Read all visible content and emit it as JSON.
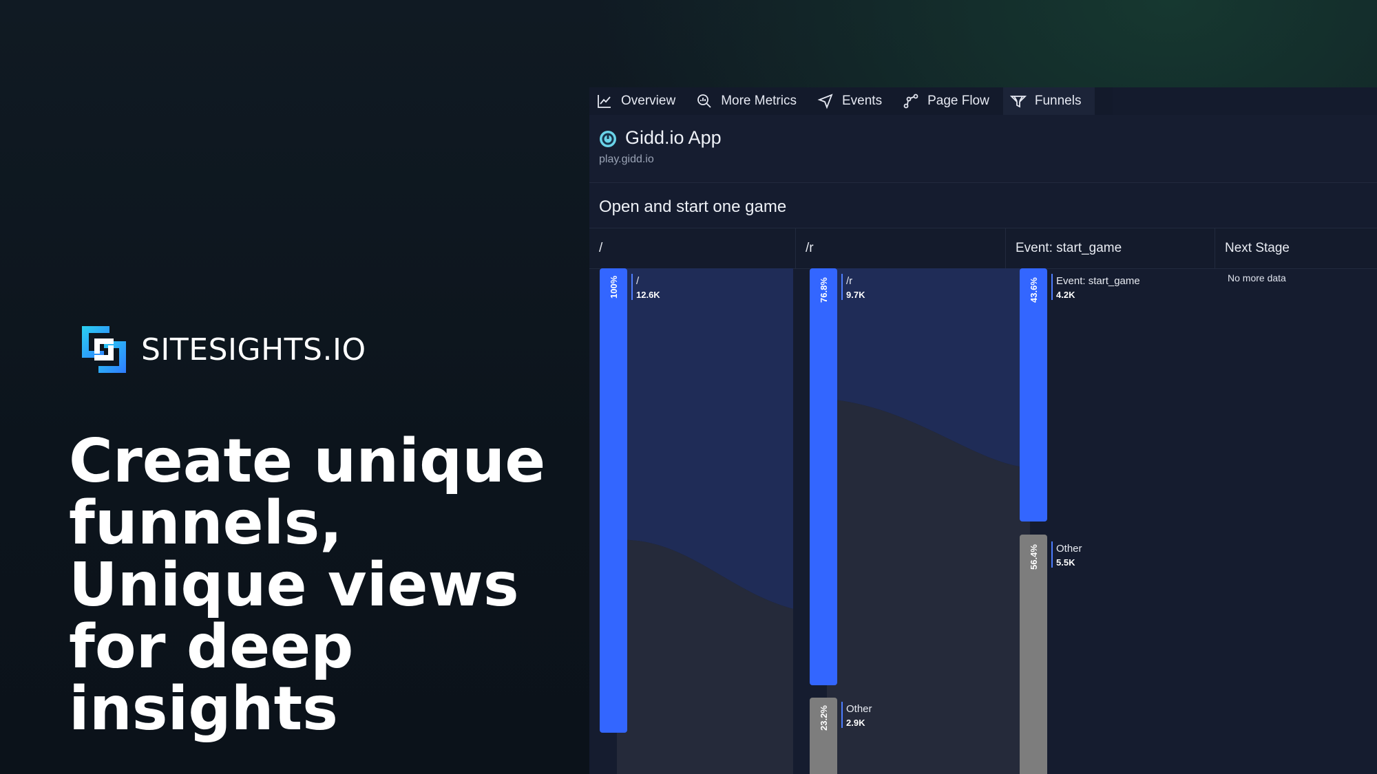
{
  "brand": {
    "name": "SITESIGHTS.IO"
  },
  "headline": "Create unique funnels, Unique views for deep insights",
  "nav": {
    "items": [
      {
        "label": "Overview",
        "icon": "line-chart-icon"
      },
      {
        "label": "More Metrics",
        "icon": "magnify-chart-icon"
      },
      {
        "label": "Events",
        "icon": "navigation-arrow-icon"
      },
      {
        "label": "Page Flow",
        "icon": "flow-nodes-icon"
      },
      {
        "label": "Funnels",
        "icon": "funnel-icon"
      }
    ],
    "active": "Funnels"
  },
  "app": {
    "title": "Gidd.io App",
    "url": "play.gidd.io"
  },
  "funnel": {
    "name": "Open and start one game"
  },
  "stages": [
    {
      "header": "/"
    },
    {
      "header": "/r"
    },
    {
      "header": "Event: start_game"
    },
    {
      "header": "Next Stage",
      "empty_text": "No more data"
    }
  ],
  "funnel_bars": [
    {
      "stage": "/",
      "label": "/",
      "count": "12.6K",
      "percent": "100%",
      "kind": "match"
    },
    {
      "stage": "/r",
      "label": "/r",
      "count": "9.7K",
      "percent": "76.8%",
      "kind": "match"
    },
    {
      "stage": "/r",
      "label": "Other",
      "count": "2.9K",
      "percent": "23.2%",
      "kind": "other"
    },
    {
      "stage": "Event: start_game",
      "label": "Event: start_game",
      "count": "4.2K",
      "percent": "43.6%",
      "kind": "match"
    },
    {
      "stage": "Event: start_game",
      "label": "Other",
      "count": "5.5K",
      "percent": "56.4%",
      "kind": "other"
    }
  ],
  "colors": {
    "match_bar": "#3366ff",
    "other_bar": "#7d7d7d",
    "flow_match": "#1f2c57",
    "flow_other": "#252a3a",
    "panel_bg": "#151c2f"
  }
}
